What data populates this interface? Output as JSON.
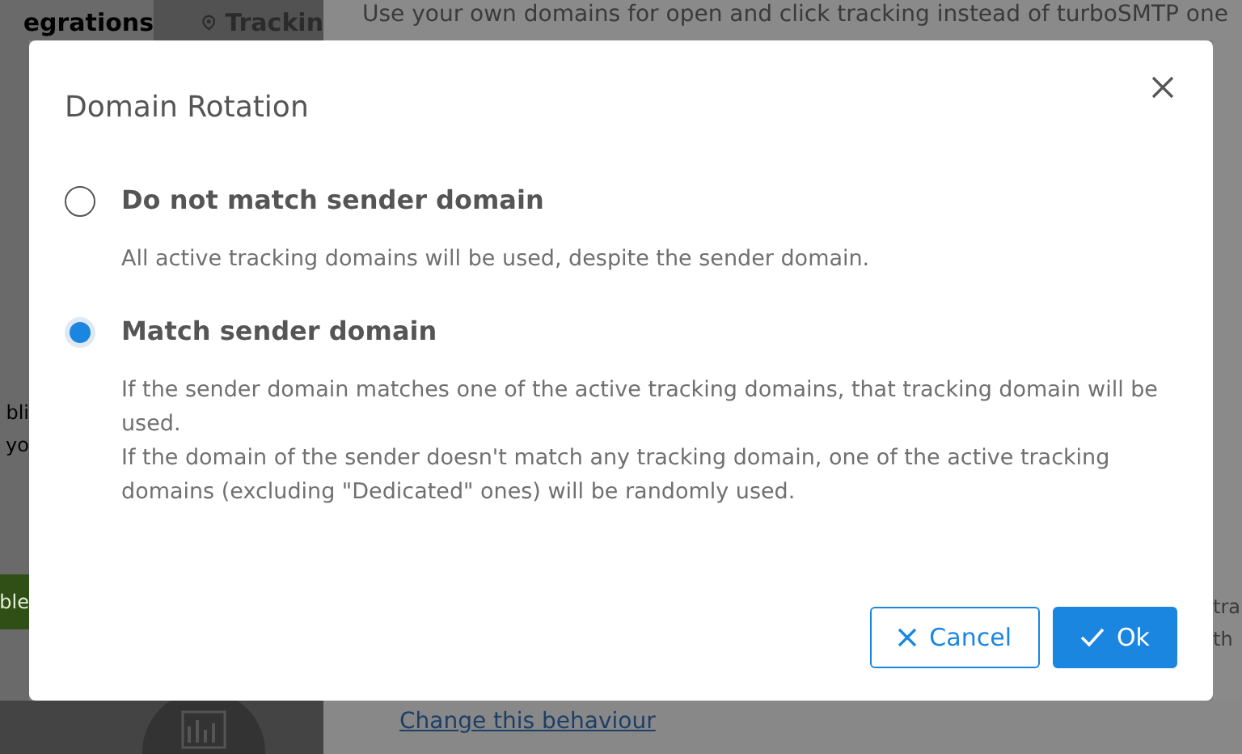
{
  "background": {
    "tabs": [
      {
        "label": "egrations",
        "kind": "plain"
      },
      {
        "label": "Trackin",
        "kind": "pin"
      }
    ],
    "intro": "Use your own domains for open and click tracking instead of turboSMTP one",
    "left_fragments": [
      "bli",
      "yo"
    ],
    "green_button": "ble",
    "right_fragments": [
      "tra",
      "th"
    ],
    "link": "Change this behaviour"
  },
  "dialog": {
    "title": "Domain Rotation",
    "options": [
      {
        "label": "Do not match sender domain",
        "selected": false,
        "description": [
          "All active tracking domains will be used, despite the sender domain."
        ]
      },
      {
        "label": "Match sender domain",
        "selected": true,
        "description": [
          "If the sender domain matches one of the active tracking domains, that tracking domain will be used.",
          "If the domain of the sender doesn't match any tracking domain, one of the active tracking domains (excluding \"Dedicated\" ones) will be randomly used."
        ]
      }
    ],
    "buttons": [
      {
        "label": "Cancel",
        "kind": "secondary"
      },
      {
        "label": "Ok",
        "kind": "primary"
      }
    ]
  }
}
